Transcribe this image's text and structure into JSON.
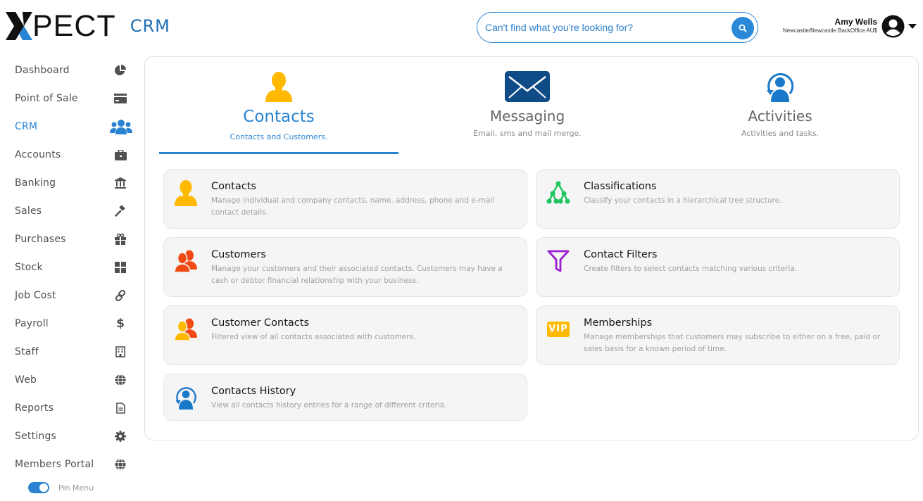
{
  "header": {
    "logo_text": "PECT",
    "logo_product": "CRM",
    "search": {
      "placeholder": "Can't find what you're looking for?",
      "value": ""
    },
    "user": {
      "name": "Amy Wells",
      "location": "Newcastle/Newcastle BackOffice AU$"
    }
  },
  "sidebar": {
    "items": [
      {
        "label": "Dashboard",
        "icon": "pie-chart-icon",
        "active": false
      },
      {
        "label": "Point of Sale",
        "icon": "credit-card-icon",
        "active": false
      },
      {
        "label": "CRM",
        "icon": "users-icon",
        "active": true
      },
      {
        "label": "Accounts",
        "icon": "briefcase-icon",
        "active": false
      },
      {
        "label": "Banking",
        "icon": "bank-icon",
        "active": false
      },
      {
        "label": "Sales",
        "icon": "gavel-icon",
        "active": false
      },
      {
        "label": "Purchases",
        "icon": "gift-icon",
        "active": false
      },
      {
        "label": "Stock",
        "icon": "grid-icon",
        "active": false
      },
      {
        "label": "Job Cost",
        "icon": "link-icon",
        "active": false
      },
      {
        "label": "Payroll",
        "icon": "dollar-icon",
        "active": false
      },
      {
        "label": "Staff",
        "icon": "building-icon",
        "active": false
      },
      {
        "label": "Web",
        "icon": "globe-icon",
        "active": false
      },
      {
        "label": "Reports",
        "icon": "document-icon",
        "active": false
      },
      {
        "label": "Settings",
        "icon": "gear-icon",
        "active": false
      },
      {
        "label": "Members Portal",
        "icon": "globe-icon",
        "active": false
      }
    ],
    "pin_menu": {
      "label": "Pin Menu",
      "on": true
    }
  },
  "tabs": [
    {
      "title": "Contacts",
      "subtitle": "Contacts and Customers.",
      "icon": "person-icon",
      "active": true
    },
    {
      "title": "Messaging",
      "subtitle": "Email, sms and mail merge.",
      "icon": "envelope-icon",
      "active": false
    },
    {
      "title": "Activities",
      "subtitle": "Activities and tasks.",
      "icon": "person-refresh-icon",
      "active": false
    }
  ],
  "cards": [
    {
      "title": "Contacts",
      "description": "Manage individual and company contacts, name, address, phone and e-mail contact details.",
      "icon": "person-icon"
    },
    {
      "title": "Classifications",
      "description": "Classify your contacts in a hierarchical tree structure.",
      "icon": "tree-icon"
    },
    {
      "title": "Customers",
      "description": "Manage your customers and their associated contacts. Customers may have a cash or debtor financial relationship with your business.",
      "icon": "customers-icon"
    },
    {
      "title": "Contact Filters",
      "description": "Create filters to select contacts matching various criteria.",
      "icon": "filter-icon"
    },
    {
      "title": "Customer Contacts",
      "description": "Filtered view of all contacts associated with customers.",
      "icon": "customer-contacts-icon"
    },
    {
      "title": "Memberships",
      "description": "Manage memberships that customers may subscribe to either on a free, paid or sales basis for a known period of time.",
      "icon": "vip-icon",
      "badge": "VIP"
    },
    {
      "title": "Contacts History",
      "description": "View all contacts history entries for a range of different criteria.",
      "icon": "history-icon"
    }
  ],
  "colors": {
    "accent": "#2a83d2",
    "contact_yellow": "#ffb900",
    "customer_orange": "#f24a14",
    "classification_green": "#1ec45c",
    "filter_purple": "#9b1fd1",
    "messaging_navy": "#0f4c87"
  }
}
